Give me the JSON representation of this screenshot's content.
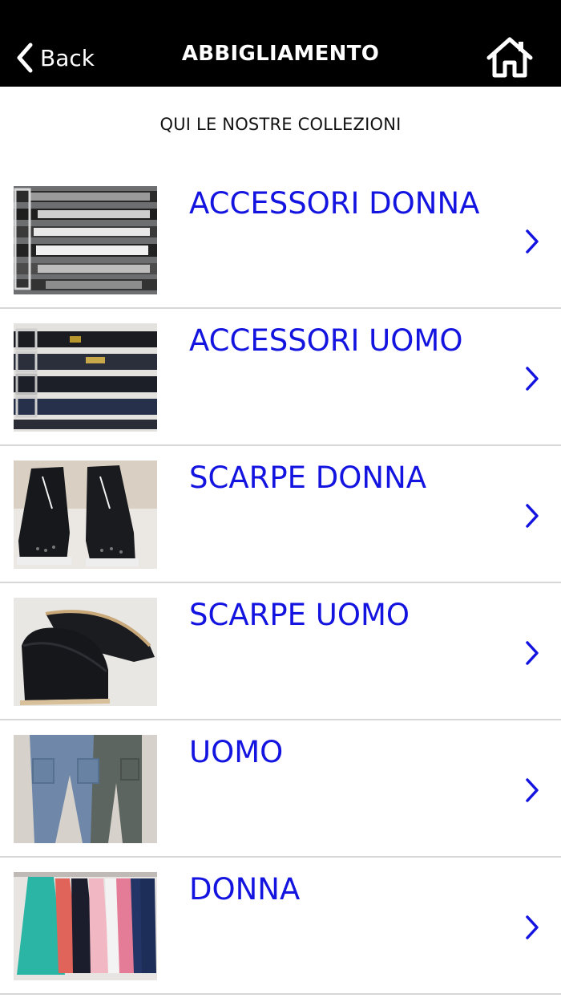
{
  "navbar": {
    "back_label": "Back",
    "title": "ABBIGLIAMENTO",
    "home_icon": "home-icon",
    "back_icon": "chevron-left-icon"
  },
  "subtitle": "QUI LE NOSTRE COLLEZIONI",
  "theme": {
    "navbar_bg": "#000000",
    "link_color": "#1414e0",
    "divider": "#d7d7d7"
  },
  "collections": [
    {
      "label": "ACCESSORI DONNA",
      "thumbnail": "women-belts-photo",
      "chevron_icon": "chevron-right-icon"
    },
    {
      "label": "ACCESSORI UOMO",
      "thumbnail": "men-belts-photo",
      "chevron_icon": "chevron-right-icon"
    },
    {
      "label": "SCARPE DONNA",
      "thumbnail": "women-sneakers-photo",
      "chevron_icon": "chevron-right-icon"
    },
    {
      "label": "SCARPE UOMO",
      "thumbnail": "men-loafers-photo",
      "chevron_icon": "chevron-right-icon"
    },
    {
      "label": "UOMO",
      "thumbnail": "men-cargo-pants-photo",
      "chevron_icon": "chevron-right-icon"
    },
    {
      "label": "DONNA",
      "thumbnail": "women-dresses-photo",
      "chevron_icon": "chevron-right-icon"
    }
  ]
}
